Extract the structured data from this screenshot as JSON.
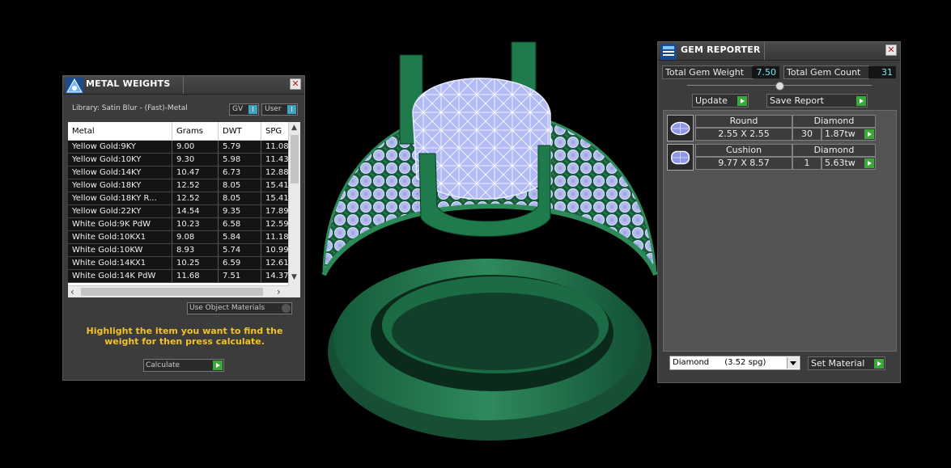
{
  "metal_weights": {
    "title": "METAL WEIGHTS",
    "library": "Library: Satin Blur - (Fast)-Metal",
    "toggle_gv": "GV",
    "toggle_user": "User",
    "columns": [
      "Metal",
      "Grams",
      "DWT",
      "SPG"
    ],
    "rows": [
      [
        "Yellow Gold:9KY",
        "9.00",
        "5.79",
        "11.08"
      ],
      [
        "Yellow Gold:10KY",
        "9.30",
        "5.98",
        "11.43"
      ],
      [
        "Yellow Gold:14KY",
        "10.47",
        "6.73",
        "12.88"
      ],
      [
        "Yellow Gold:18KY",
        "12.52",
        "8.05",
        "15.41"
      ],
      [
        "Yellow Gold:18KY R...",
        "12.52",
        "8.05",
        "15.41"
      ],
      [
        "Yellow Gold:22KY",
        "14.54",
        "9.35",
        "17.89"
      ],
      [
        "White Gold:9K PdW",
        "10.23",
        "6.58",
        "12.59"
      ],
      [
        "White Gold:10KX1",
        "9.08",
        "5.84",
        "11.18"
      ],
      [
        "White Gold:10KW",
        "8.93",
        "5.74",
        "10.99"
      ],
      [
        "White Gold:14KX1",
        "10.25",
        "6.59",
        "12.61"
      ],
      [
        "White Gold:14K PdW",
        "11.68",
        "7.51",
        "14.37"
      ]
    ],
    "use_object_materials": "Use Object Materials",
    "hint": "Highlight the item you want to find the weight for then press calculate.",
    "calculate": "Calculate"
  },
  "gem_reporter": {
    "title": "GEM REPORTER",
    "total_weight_label": "Total Gem Weight",
    "total_weight": "7.50",
    "total_count_label": "Total Gem Count",
    "total_count": "31",
    "update": "Update",
    "save_report": "Save Report",
    "gems": [
      {
        "shape": "Round",
        "material": "Diamond",
        "size": "2.55 X 2.55",
        "count": "30",
        "weight": "1.87tw"
      },
      {
        "shape": "Cushion",
        "material": "Diamond",
        "size": "9.77 X 8.57",
        "count": "1",
        "weight": "5.63tw"
      }
    ],
    "material_select": "Diamond      (3.52 spg)",
    "set_material": "Set Material"
  },
  "colors": {
    "panel_bg": "#3c3c3c",
    "accent_cyan": "#76e4f2",
    "hint_yellow": "#f2c12e",
    "go_green": "#3aa83a",
    "ring_green": "#1f6b45",
    "gem_blue": "#a9b3f0"
  },
  "icons": [
    "metal-weights-icon",
    "gem-reporter-icon",
    "close-icon",
    "round-gem-icon",
    "cushion-gem-icon",
    "go-arrow-icon",
    "dropdown-arrow-icon"
  ]
}
